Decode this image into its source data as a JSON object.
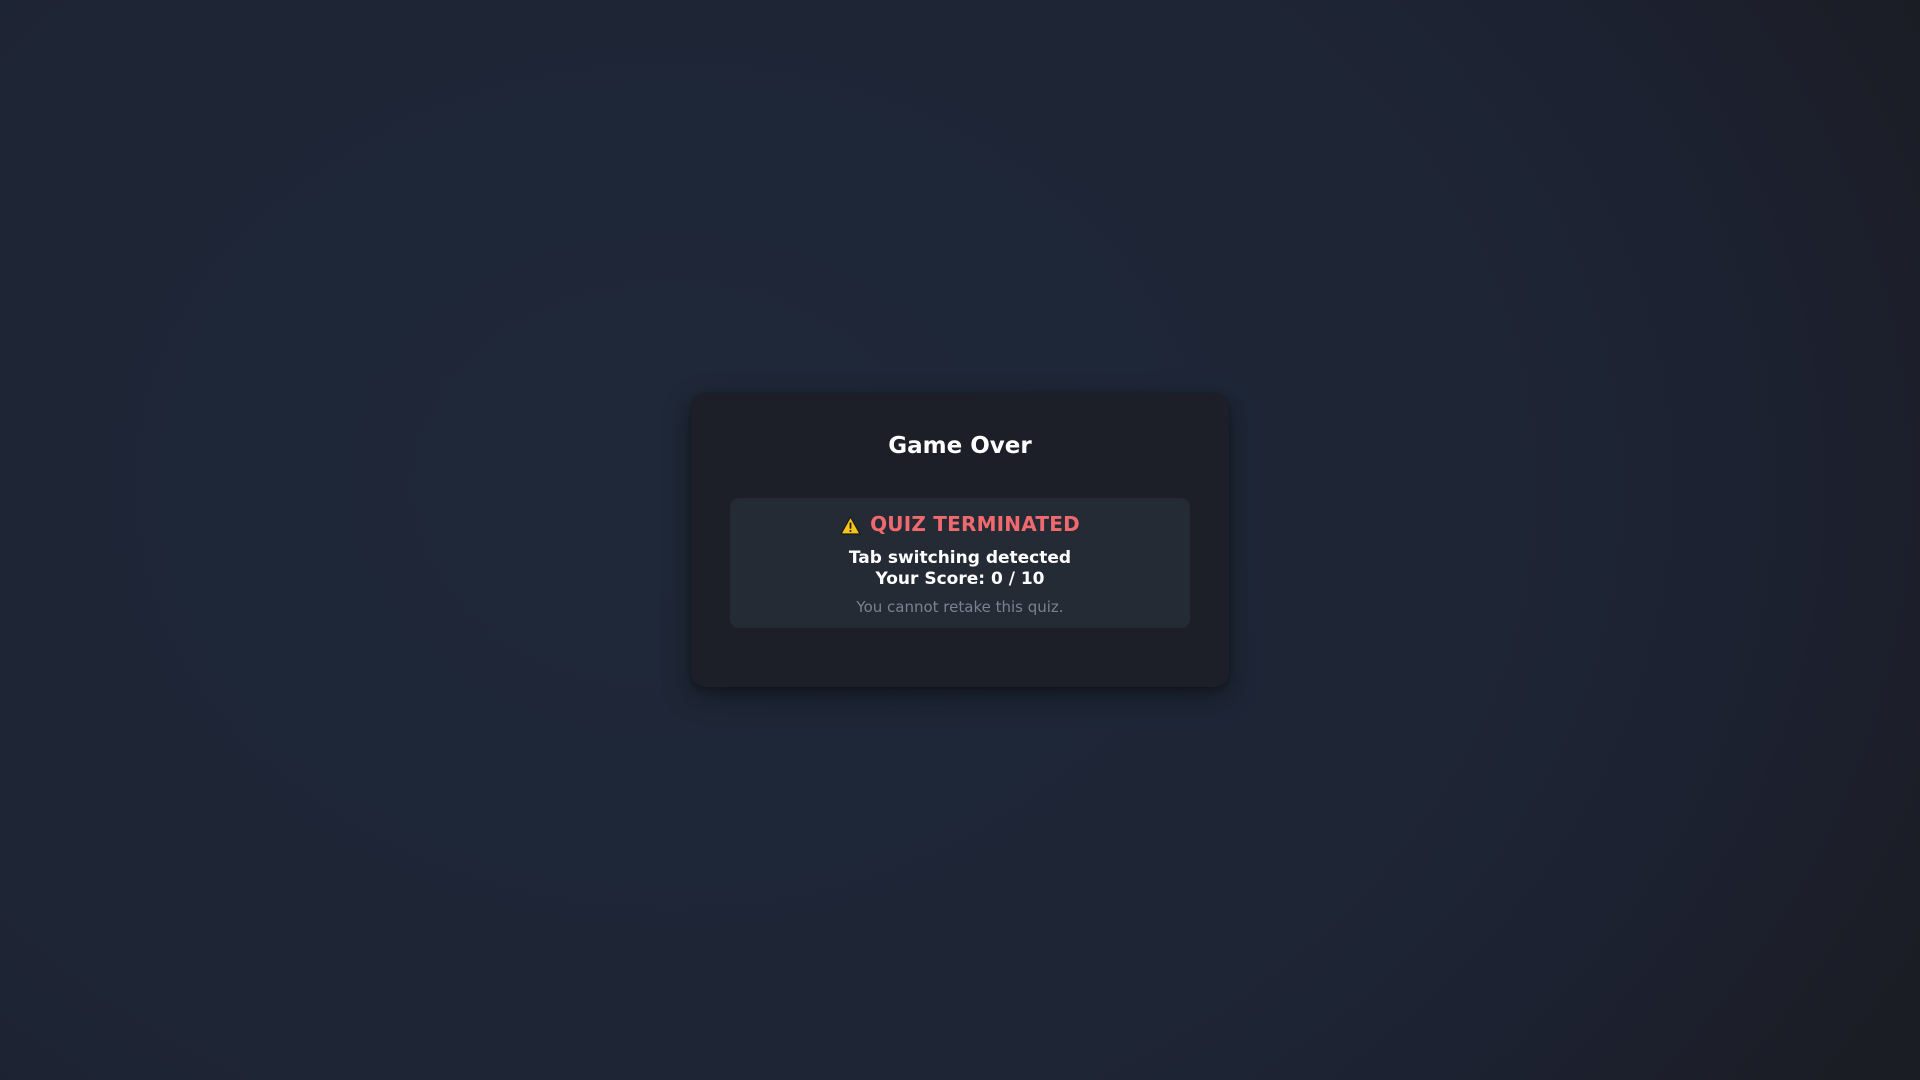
{
  "dialog": {
    "title": "Game Over",
    "status": {
      "icon": "warning-icon",
      "label": "QUIZ TERMINATED",
      "color": "#f0696e"
    },
    "reason": "Tab switching detected",
    "score_text": "Your Score: 0 / 10",
    "note": "You cannot retake this quiz."
  }
}
